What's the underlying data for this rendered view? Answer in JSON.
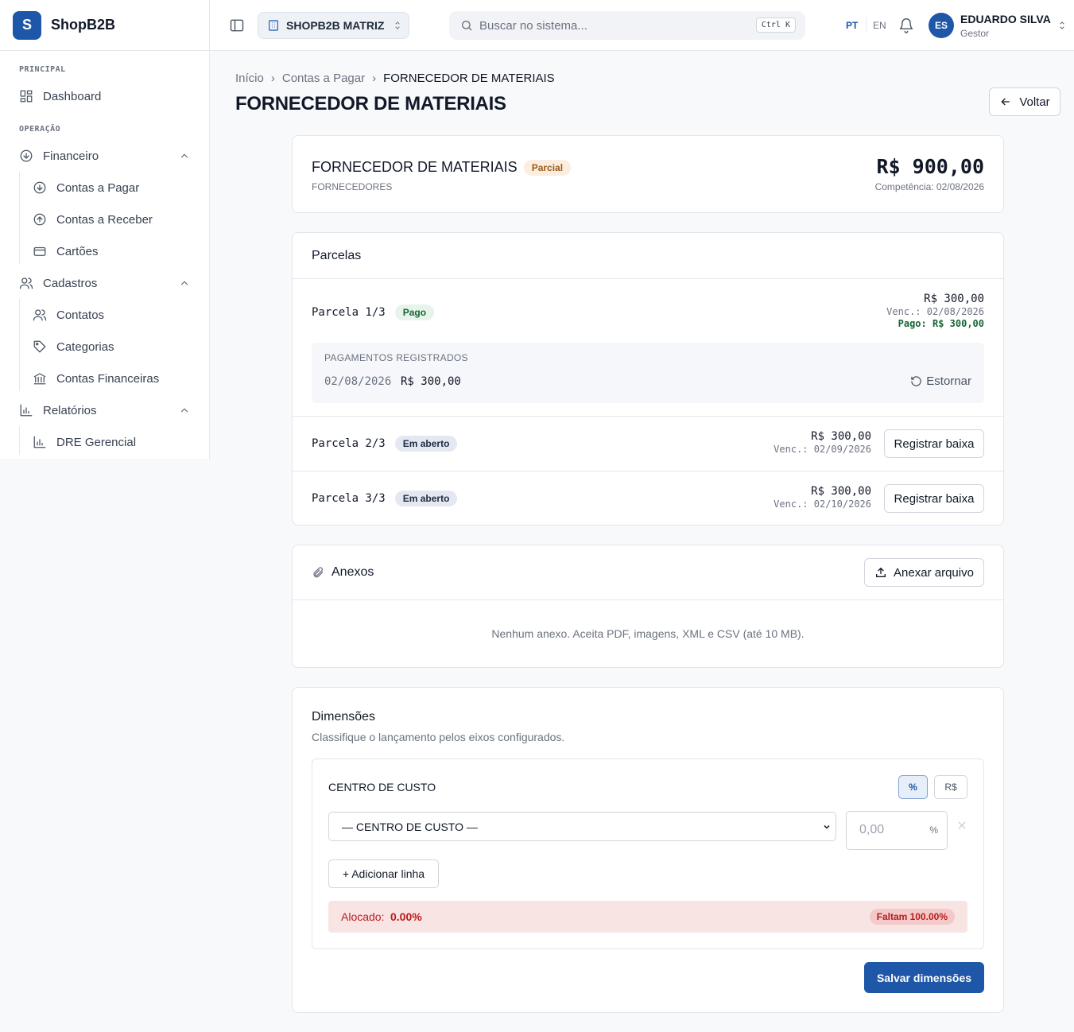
{
  "brand": {
    "logo_letter": "S",
    "name": "ShopB2B"
  },
  "sidebar": {
    "sections": [
      {
        "label": "PRINCIPAL"
      },
      {
        "label": "OPERAÇÃO"
      }
    ],
    "items": {
      "dashboard": "Dashboard",
      "financeiro": "Financeiro",
      "contas_pagar": "Contas a Pagar",
      "contas_receber": "Contas a Receber",
      "cartoes": "Cartões",
      "cadastros": "Cadastros",
      "contatos": "Contatos",
      "categorias": "Categorias",
      "contas_financeiras": "Contas Financeiras",
      "relatorios": "Relatórios",
      "dre": "DRE Gerencial"
    }
  },
  "topbar": {
    "store": "SHOPB2B MATRIZ",
    "search_placeholder": "Buscar no sistema...",
    "search_shortcut": "Ctrl K",
    "lang_pt": "PT",
    "lang_en": "EN",
    "user_initials": "ES",
    "user_name": "EDUARDO SILVA",
    "user_role": "Gestor"
  },
  "breadcrumb": {
    "home": "Início",
    "section": "Contas a Pagar",
    "current": "FORNECEDOR DE MATERIAIS"
  },
  "page": {
    "title": "FORNECEDOR DE MATERIAIS",
    "back_label": "Voltar"
  },
  "summary": {
    "name": "FORNECEDOR DE MATERIAIS",
    "status": "Parcial",
    "category": "FORNECEDORES",
    "amount": "R$ 900,00",
    "competencia": "Competência: 02/08/2026"
  },
  "parcelas": {
    "title": "Parcelas",
    "items": [
      {
        "label": "Parcela 1/3",
        "status": "Pago",
        "value": "R$ 300,00",
        "venc": "Venc.: 02/08/2026",
        "pago": "Pago: R$ 300,00"
      },
      {
        "label": "Parcela 2/3",
        "status": "Em aberto",
        "value": "R$ 300,00",
        "venc": "Venc.: 02/09/2026",
        "action": "Registrar baixa"
      },
      {
        "label": "Parcela 3/3",
        "status": "Em aberto",
        "value": "R$ 300,00",
        "venc": "Venc.: 02/10/2026",
        "action": "Registrar baixa"
      }
    ],
    "payments_header": "PAGAMENTOS REGISTRADOS",
    "payment": {
      "date": "02/08/2026",
      "value": "R$ 300,00",
      "action": "Estornar"
    }
  },
  "anexos": {
    "title": "Anexos",
    "button": "Anexar arquivo",
    "empty": "Nenhum anexo. Aceita PDF, imagens, XML e CSV (até 10 MB)."
  },
  "dimensoes": {
    "title": "Dimensões",
    "subtitle": "Classifique o lançamento pelos eixos configurados.",
    "axis": "CENTRO DE CUSTO",
    "mode_pct": "%",
    "mode_brl": "R$",
    "select_value": "— CENTRO DE CUSTO —",
    "amount_placeholder": "0,00",
    "amount_unit": "%",
    "add_line": "+ Adicionar linha",
    "alloc_label": "Alocado:",
    "alloc_value": "0.00%",
    "missing": "Faltam 100.00%",
    "save": "Salvar dimensões"
  },
  "colors": {
    "accent": "#1e56a8",
    "paid": "#166534",
    "danger": "#b91c1c"
  }
}
